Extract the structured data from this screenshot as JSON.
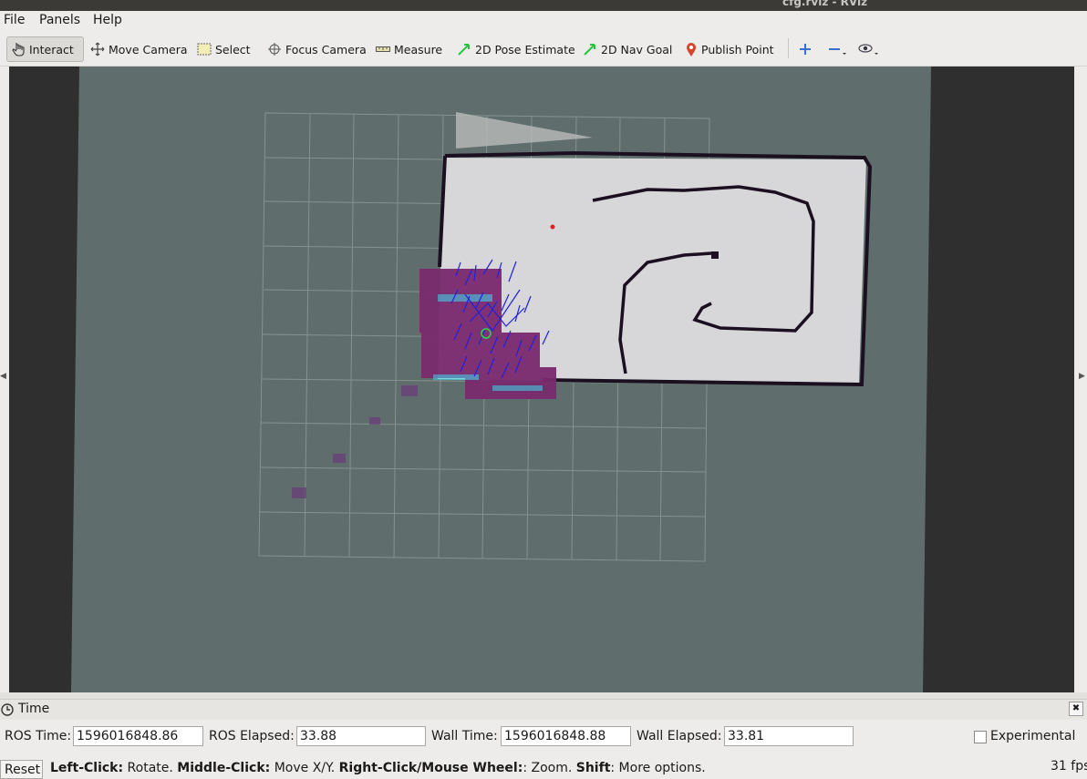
{
  "window": {
    "title": "cfg.rviz - RViz"
  },
  "menu": {
    "file": "File",
    "panels": "Panels",
    "help": "Help"
  },
  "toolbar": {
    "interact": "Interact",
    "move_camera": "Move Camera",
    "select": "Select",
    "focus_camera": "Focus Camera",
    "measure": "Measure",
    "pose_estimate": "2D Pose Estimate",
    "nav_goal": "2D Nav Goal",
    "publish_point": "Publish Point"
  },
  "time_panel": {
    "title": "Time",
    "ros_time_label": "ROS Time:",
    "ros_time": "1596016848.86",
    "ros_elapsed_label": "ROS Elapsed:",
    "ros_elapsed": "33.88",
    "wall_time_label": "Wall Time:",
    "wall_time": "1596016848.88",
    "wall_elapsed_label": "Wall Elapsed:",
    "wall_elapsed": "33.81",
    "experimental": "Experimental"
  },
  "status": {
    "reset": "Reset",
    "left_click": "Left-Click:",
    "rotate": " Rotate. ",
    "middle_click": "Middle-Click:",
    "move_xy": " Move X/Y. ",
    "right_click": "Right-Click/Mouse Wheel:",
    "zoom": ": Zoom. ",
    "shift": "Shift",
    "more": ": More options.",
    "fps": "31 fps"
  },
  "colors": {
    "viewport_bg": "#2f2f2f",
    "map_unknown": "#5f6e6c",
    "map_free": "#d7d6d8",
    "obstacle": "#1a1020",
    "inflation": "#7a2a6e",
    "particles": "#2020e0",
    "grid": "#8c9896"
  }
}
